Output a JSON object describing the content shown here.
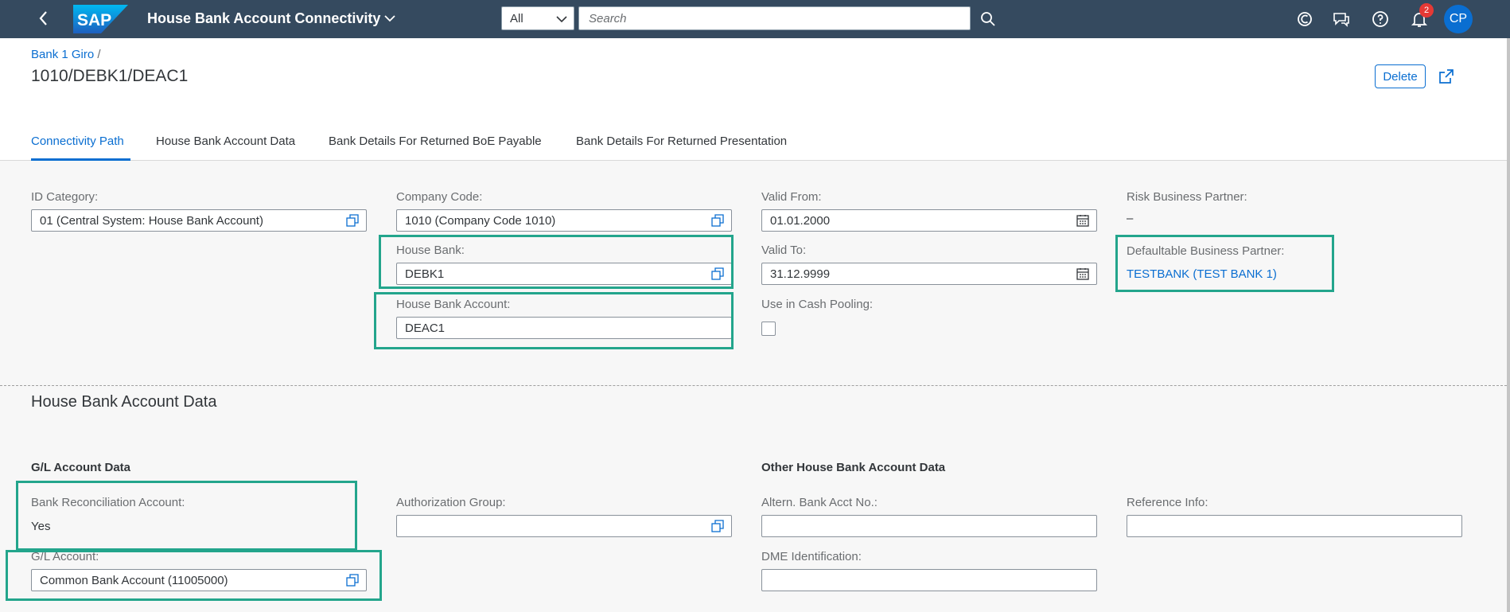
{
  "shell": {
    "title": "House Bank Account Connectivity",
    "logo_text": "SAP",
    "search_scope": "All",
    "search_placeholder": "Search",
    "notification_count": "2",
    "avatar_initials": "CP"
  },
  "header": {
    "breadcrumb_link": "Bank 1 Giro",
    "breadcrumb_sep": "/",
    "object_title": "1010/DEBK1/DEAC1",
    "delete_label": "Delete",
    "tabs": [
      {
        "label": "Connectivity Path",
        "active": true
      },
      {
        "label": "House Bank Account Data",
        "active": false
      },
      {
        "label": "Bank Details For Returned BoE Payable",
        "active": false
      },
      {
        "label": "Bank Details For Returned Presentation",
        "active": false
      }
    ]
  },
  "connectivity": {
    "id_category_label": "ID Category:",
    "id_category_value": "01 (Central System: House Bank Account)",
    "company_code_label": "Company Code:",
    "company_code_value": "1010 (Company Code 1010)",
    "house_bank_label": "House Bank:",
    "house_bank_value": "DEBK1",
    "house_bank_account_label": "House Bank Account:",
    "house_bank_account_value": "DEAC1",
    "valid_from_label": "Valid From:",
    "valid_from_value": "01.01.2000",
    "valid_to_label": "Valid To:",
    "valid_to_value": "31.12.9999",
    "cash_pooling_label": "Use in Cash Pooling:",
    "cash_pooling_checked": false,
    "risk_bp_label": "Risk Business Partner:",
    "risk_bp_value": "–",
    "defaultable_bp_label": "Defaultable Business Partner:",
    "defaultable_bp_value": "TESTBANK (TEST BANK 1)"
  },
  "account_data": {
    "section_title": "House Bank Account Data",
    "gl_group_title": "G/L Account Data",
    "bank_recon_label": "Bank Reconciliation Account:",
    "bank_recon_value": "Yes",
    "gl_account_label": "G/L Account:",
    "gl_account_value": "Common Bank Account (11005000)",
    "auth_group_label": "Authorization Group:",
    "auth_group_value": "",
    "other_group_title": "Other House Bank Account Data",
    "altern_acct_label": "Altern. Bank Acct No.:",
    "altern_acct_value": "",
    "reference_label": "Reference Info:",
    "reference_value": "",
    "dme_label": "DME Identification:",
    "dme_value": ""
  },
  "colors": {
    "shell_bg": "#354a5f",
    "accent": "#0a6ed1",
    "highlight": "#23a58c",
    "badge": "#e53935"
  }
}
